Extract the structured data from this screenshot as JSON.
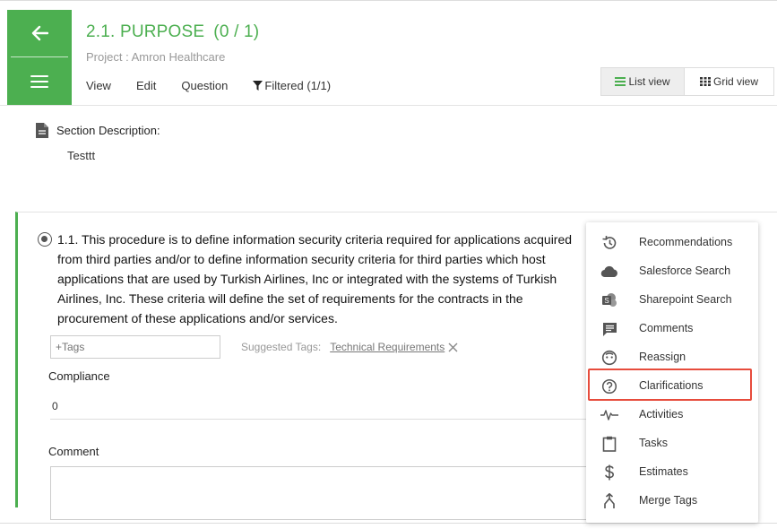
{
  "header": {
    "title": "2.1. PURPOSE",
    "count": "(0 / 1)",
    "subtitle": "Project : Amron Healthcare",
    "toolbar": {
      "view": "View",
      "edit": "Edit",
      "question": "Question",
      "filtered": "Filtered (1/1)"
    },
    "view_toggle": {
      "list": "List view",
      "grid": "Grid view"
    }
  },
  "section": {
    "label": "Section Description:",
    "text": "Testtt"
  },
  "question": {
    "text": "1.1. This procedure is to define information security criteria required for applications acquired from third parties and/or to define information security criteria for third parties which host applications that are used by Turkish Airlines, Inc or integrated with the systems of Turkish Airlines, Inc. These criteria will define the set of requirements for the contracts in the procurement of these applications and/or services.",
    "tags_placeholder": "+Tags",
    "suggested_label": "Suggested Tags:",
    "suggested_tag": "Technical Requirements",
    "compliance_label": "Compliance",
    "compliance_value": "0",
    "comment_label": "Comment"
  },
  "context_menu": {
    "items": [
      {
        "label": "Recommendations",
        "icon": "history-icon"
      },
      {
        "label": "Salesforce Search",
        "icon": "cloud-icon"
      },
      {
        "label": "Sharepoint Search",
        "icon": "sharepoint-icon"
      },
      {
        "label": "Comments",
        "icon": "comment-icon"
      },
      {
        "label": "Reassign",
        "icon": "face-icon"
      },
      {
        "label": "Clarifications",
        "icon": "question-circle-icon"
      },
      {
        "label": "Activities",
        "icon": "pulse-icon"
      },
      {
        "label": "Tasks",
        "icon": "clipboard-icon"
      },
      {
        "label": "Estimates",
        "icon": "dollar-icon"
      },
      {
        "label": "Merge Tags",
        "icon": "merge-icon"
      }
    ],
    "highlighted": "Clarifications"
  },
  "colors": {
    "accent": "#4caf50",
    "highlight": "#e74c3c"
  }
}
